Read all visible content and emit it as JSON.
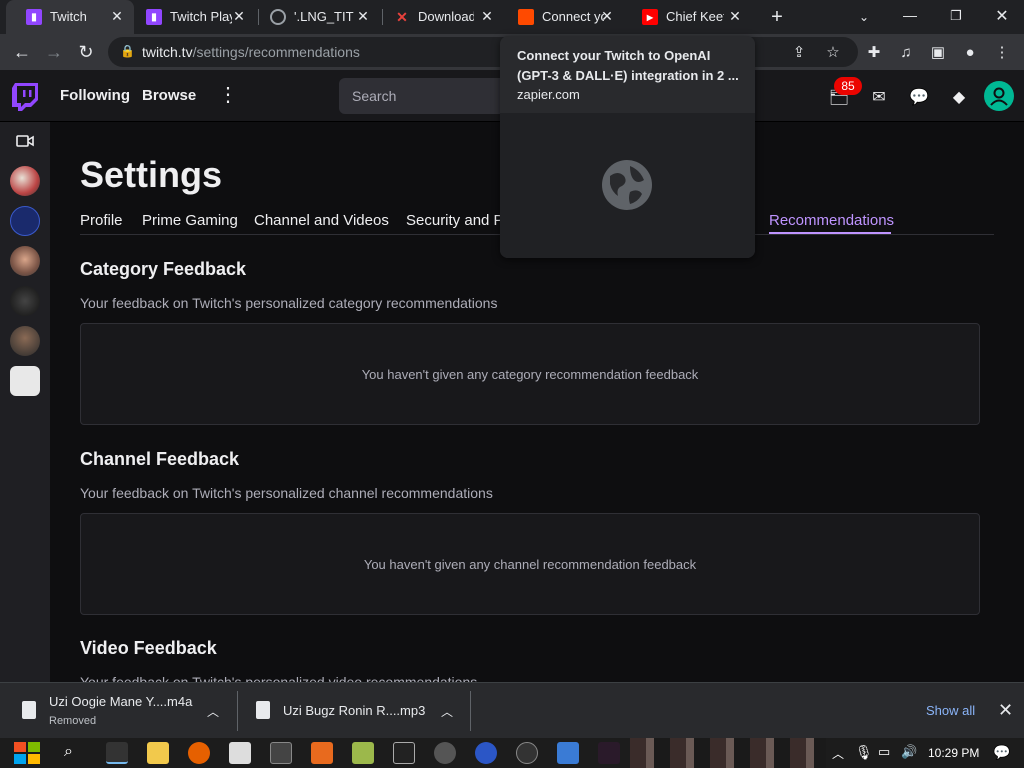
{
  "browser": {
    "tabs": [
      {
        "label": "Twitch",
        "favicon": "twitch-icon",
        "color": "#9146ff"
      },
      {
        "label": "Twitch Playe",
        "favicon": "twitch-icon",
        "color": "#9146ff"
      },
      {
        "label": "'.LNG_TITLE",
        "favicon": "globe-icon",
        "color": "#9aa0a6"
      },
      {
        "label": "Download",
        "favicon": "x-logo-icon",
        "color": "#e8413c"
      },
      {
        "label": "Connect yo",
        "favicon": "zapier-icon",
        "color": "#ff4a00"
      },
      {
        "label": "Chief Keef",
        "favicon": "youtube-icon",
        "color": "#ff0000"
      }
    ],
    "url_host": "twitch.tv",
    "url_path": "/settings/recommendations",
    "hover_card": {
      "title": "Connect your Twitch to OpenAI (GPT-3 & DALL·E) integration in 2 ...",
      "domain": "zapier.com"
    }
  },
  "twitch_nav": {
    "following": "Following",
    "browse": "Browse",
    "search_placeholder": "Search",
    "notification_count": "85"
  },
  "settings": {
    "title": "Settings",
    "tabs": [
      "Profile",
      "Prime Gaming",
      "Channel and Videos",
      "Security and P",
      "Recommendations"
    ],
    "active_tab": "Recommendations",
    "sections": [
      {
        "title": "Category Feedback",
        "description": "Your feedback on Twitch's personalized category recommendations",
        "empty": "You haven't given any category recommendation feedback"
      },
      {
        "title": "Channel Feedback",
        "description": "Your feedback on Twitch's personalized channel recommendations",
        "empty": "You haven't given any channel recommendation feedback"
      },
      {
        "title": "Video Feedback",
        "description": "Your feedback on Twitch's personalized video recommendations"
      }
    ]
  },
  "downloads": {
    "items": [
      {
        "name": "Uzi Oogie Mane Y....m4a",
        "status": "Removed"
      },
      {
        "name": "Uzi Bugz Ronin R....mp3",
        "status": ""
      }
    ],
    "show_all": "Show all"
  },
  "taskbar": {
    "time": "10:29 PM"
  },
  "colors": {
    "twitch_purple": "#9146ff",
    "accent": "#bf94ff",
    "badge": "#eb0400"
  }
}
